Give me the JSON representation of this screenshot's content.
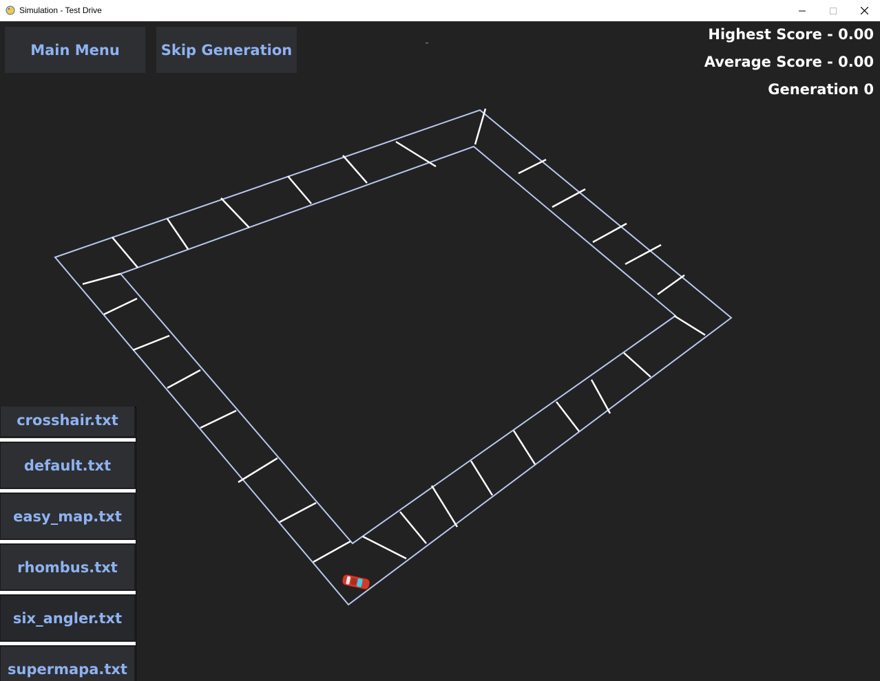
{
  "window": {
    "title": "Simulation - Test Drive",
    "app_icon": "pygame-snake-icon",
    "controls": [
      "minimize-icon",
      "maximize-icon",
      "close-icon"
    ]
  },
  "toolbar": {
    "main_menu_label": "Main Menu",
    "skip_generation_label": "Skip Generation"
  },
  "stats": {
    "highest_score": "Highest Score - 0.00",
    "average_score": "Average Score - 0.00",
    "generation": "Generation 0"
  },
  "map_list": {
    "items": [
      "crosshair.txt",
      "default.txt",
      "easy_map.txt",
      "rhombus.txt",
      "six_angler.txt",
      "supermapa.txt"
    ]
  },
  "colors": {
    "background": "#222222",
    "button_bg": "#2d2f33",
    "button_text": "#8fb2f0",
    "track_border": "#b8c8f0",
    "checkpoint": "#ffffff",
    "car": "#d03a2a",
    "car_window": "#3fd0e8"
  }
}
